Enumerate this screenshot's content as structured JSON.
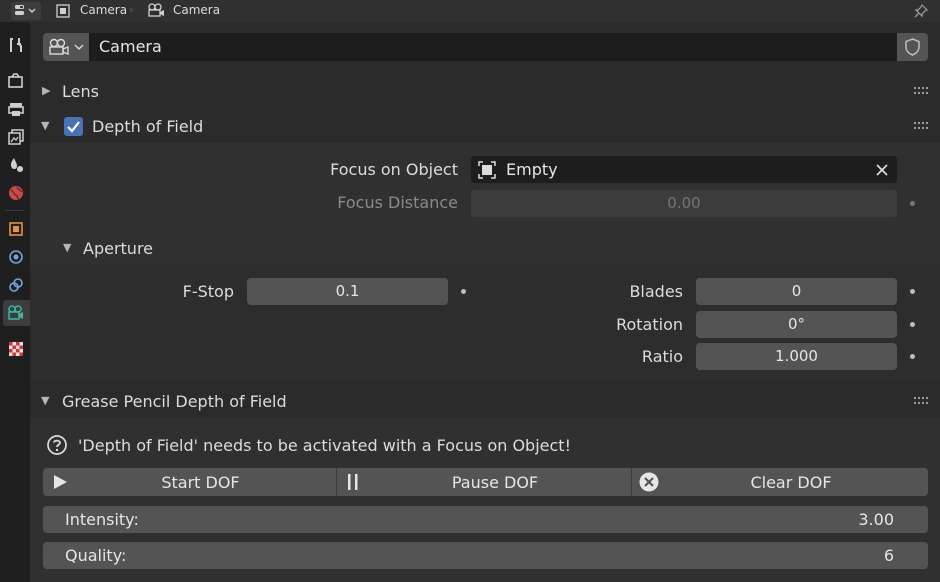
{
  "header": {
    "breadcrumb_object": "Camera",
    "breadcrumb_data": "Camera"
  },
  "datablock": {
    "name": "Camera"
  },
  "panels": {
    "lens": {
      "label": "Lens"
    },
    "dof": {
      "label": "Depth of Field",
      "enabled": true,
      "focus_object_label": "Focus on Object",
      "focus_object_value": "Empty",
      "focus_distance_label": "Focus Distance",
      "focus_distance_value": "0.00",
      "aperture": {
        "label": "Aperture",
        "fstop_label": "F-Stop",
        "fstop_value": "0.1",
        "blades_label": "Blades",
        "blades_value": "0",
        "rotation_label": "Rotation",
        "rotation_value": "0°",
        "ratio_label": "Ratio",
        "ratio_value": "1.000"
      }
    },
    "gp_dof": {
      "label": "Grease Pencil Depth of Field",
      "message": "'Depth of Field' needs to be activated with a Focus on Object!",
      "start_label": "Start DOF",
      "pause_label": "Pause DOF",
      "clear_label": "Clear DOF",
      "intensity_label": "Intensity:",
      "intensity_value": "3.00",
      "quality_label": "Quality:",
      "quality_value": "6"
    }
  },
  "colors": {
    "accent": "#4772b3",
    "active_tab_icon": "#37b8a4"
  }
}
